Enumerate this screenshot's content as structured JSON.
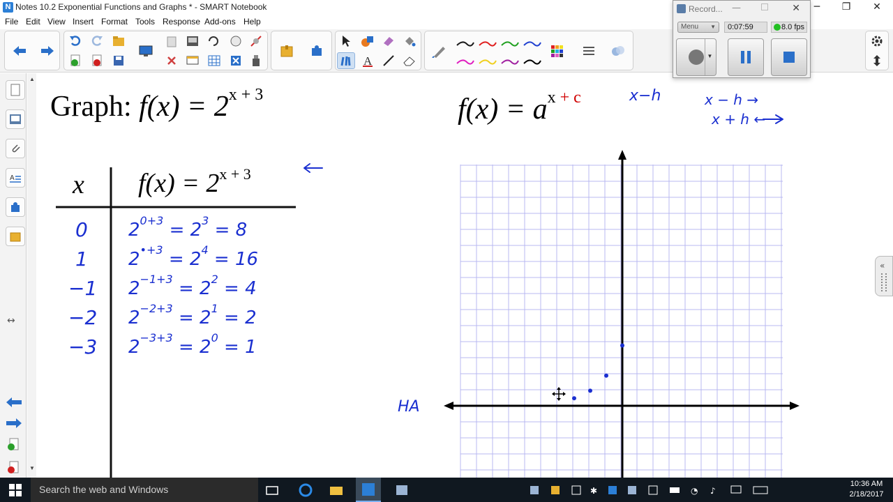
{
  "window": {
    "title": "Notes 10.2 Exponential Functions and Graphs * - SMART Notebook",
    "icons": {
      "minimize": "─",
      "restore": "❐",
      "close": "✕"
    }
  },
  "menu": [
    "File",
    "Edit",
    "View",
    "Insert",
    "Format",
    "Tools",
    "Response",
    "Add-ons",
    "Help"
  ],
  "recorder": {
    "title": "Record...",
    "menu_label": "Menu",
    "time": "0:07:59",
    "fps": "8.0 fps",
    "buttons": [
      "record-button",
      "pause-button",
      "stop-button"
    ]
  },
  "toolbar": {
    "icons": [
      "back-arrow-icon",
      "forward-arrow-icon",
      "undo-icon",
      "redo-icon",
      "open-icon",
      "add-page-icon",
      "delete-page-icon",
      "save-icon",
      "screen-capture-icon",
      "paste-icon",
      "delete-icon",
      "screen-shade-icon",
      "table-icon",
      "clear-page-icon",
      "full-screen-icon",
      "lesson-activity-icon",
      "add-ons-icon",
      "select-icon",
      "pens-icon",
      "shapes-icon",
      "text-icon",
      "eraser-icon",
      "line-icon",
      "magic-pen-icon",
      "color-palette-icon",
      "line-style-icon",
      "properties-icon",
      "settings-icon",
      "move-toolbar-icon"
    ],
    "pen_colors": [
      "#1a1a1a",
      "#e02020",
      "#20a020",
      "#2040d0",
      "#e020c0",
      "#f0d020",
      "#a020a0",
      "#000000"
    ]
  },
  "sidebar": {
    "icons": [
      "page-sorter-icon",
      "gallery-icon",
      "attachments-icon",
      "properties-icon",
      "add-ons-icon",
      "lesson-activity-icon",
      "expand-icon",
      "previous-page-icon",
      "next-page-icon",
      "add-page-icon",
      "delete-page-icon"
    ]
  },
  "canvas": {
    "heading": {
      "prefix": "Graph: ",
      "func": "f(x) = 2",
      "exp": "x + 3"
    },
    "general_form": {
      "func": "f(x) = a",
      "exp_x": "x",
      "exp_rest": " + c",
      "exp_rest_color": "#d00000"
    },
    "table": {
      "col_x": "x",
      "col_f": "f(x) = 2",
      "col_f_exp": "x + 3",
      "rows": [
        {
          "x": "0",
          "base": "2",
          "exp": "0+3",
          "rest": "= 2",
          "pow": "3",
          "result": "= 8"
        },
        {
          "x": "1",
          "base": "2",
          "exp": "•+3",
          "rest": "= 2",
          "pow": "4",
          "result": "= 16"
        },
        {
          "x": "−1",
          "base": "2",
          "exp": "−1+3",
          "rest": "= 2",
          "pow": "2",
          "result": "= 4"
        },
        {
          "x": "−2",
          "base": "2",
          "exp": "−2+3",
          "rest": "= 2",
          "pow": "1",
          "result": "= 2"
        },
        {
          "x": "−3",
          "base": "2",
          "exp": "−3+3",
          "rest": "= 2",
          "pow": "0",
          "result": "= 1"
        }
      ]
    },
    "notes": {
      "shift_left": "x−h",
      "right_rule": "x − h →",
      "left_rule": "x + h ←",
      "ha_label": "HA",
      "ink_color": "#1a2fd0"
    },
    "graph": {
      "x_range": [
        -10,
        10
      ],
      "y_range": [
        -4,
        15
      ],
      "plotted_points": [
        {
          "x": 0,
          "y": 8
        },
        {
          "x": -1,
          "y": 4
        },
        {
          "x": -2,
          "y": 2
        },
        {
          "x": -3,
          "y": 1
        }
      ],
      "grid_color": "#b8b8f0",
      "point_color": "#1a2fd0"
    }
  },
  "taskbar": {
    "search_placeholder": "Search the web and Windows",
    "time": "10:36 AM",
    "date": "2/18/2017"
  }
}
